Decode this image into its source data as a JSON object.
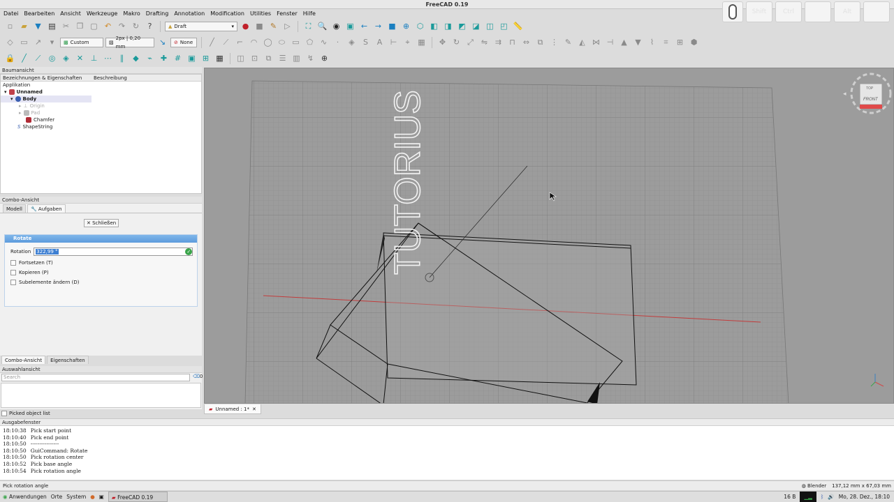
{
  "window": {
    "title": "FreeCAD 0.19"
  },
  "keys": [
    {
      "label": ""
    },
    {
      "label": "Shift"
    },
    {
      "label": "Ctrl"
    },
    {
      "label": ""
    },
    {
      "label": "Alt"
    },
    {
      "label": ""
    }
  ],
  "menu": [
    "Datei",
    "Bearbeiten",
    "Ansicht",
    "Werkzeuge",
    "Makro",
    "Drafting",
    "Annotation",
    "Modification",
    "Utilities",
    "Fenster",
    "Hilfe"
  ],
  "toolbar": {
    "workbench": "Draft",
    "style_label": "Custom",
    "line_width": "2px | 0,20 mm",
    "face_style": "None"
  },
  "tree": {
    "header": "Baumansicht",
    "col_labels": "Bezeichnungen & Eigenschaften",
    "col_desc": "Beschreibung",
    "root_label": "Applikation",
    "items": [
      {
        "label": "Unnamed"
      },
      {
        "label": "Body"
      },
      {
        "label": "Origin"
      },
      {
        "label": "Pad"
      },
      {
        "label": "Chamfer"
      },
      {
        "label": "ShapeString"
      }
    ]
  },
  "combo": {
    "header": "Combo-Ansicht",
    "tab_model": "Modell",
    "tab_tasks": "Aufgaben",
    "close_label": "Schließen",
    "task_title": "Rotate",
    "rotation_label": "Rotation",
    "rotation_value": "322,99 °",
    "opt_continue": "Fortsetzen (T)",
    "opt_copy": "Kopieren (P)",
    "opt_subelements": "Subelemente ändern (D)"
  },
  "bottom_tabs": {
    "combo": "Combo-Ansicht",
    "props": "Eigenschaften"
  },
  "selection": {
    "header": "Auswahlansicht",
    "search_placeholder": "Search",
    "count": "0",
    "picked_label": "Picked object list"
  },
  "document_tab": {
    "label": "Unnamed : 1*"
  },
  "viewport": {
    "shape_text": "TUTORIUS",
    "navcube_top": "TOP",
    "navcube_front": "FRONT"
  },
  "output": {
    "header": "Ausgabefenster",
    "lines": [
      {
        "time": "18:10:38",
        "msg": "Pick start point"
      },
      {
        "time": "18:10:40",
        "msg": "Pick end point"
      },
      {
        "time": "18:10:50",
        "msg": "----------------"
      },
      {
        "time": "18:10:50",
        "msg": "GuiCommand: Rotate"
      },
      {
        "time": "18:10:50",
        "msg": "Pick rotation center"
      },
      {
        "time": "18:10:52",
        "msg": "Pick base angle"
      },
      {
        "time": "18:10:54",
        "msg": "Pick rotation angle"
      }
    ]
  },
  "status": {
    "message": "Pick rotation angle",
    "nav_style": "Blender",
    "dimensions": "137,12 mm x 67,03 mm"
  },
  "taskbar": {
    "apps": "Anwendungen",
    "places": "Orte",
    "system": "System",
    "active_window": "FreeCAD 0.19",
    "net": "16 B",
    "datetime": "Mo, 28. Dez., 18:10"
  }
}
